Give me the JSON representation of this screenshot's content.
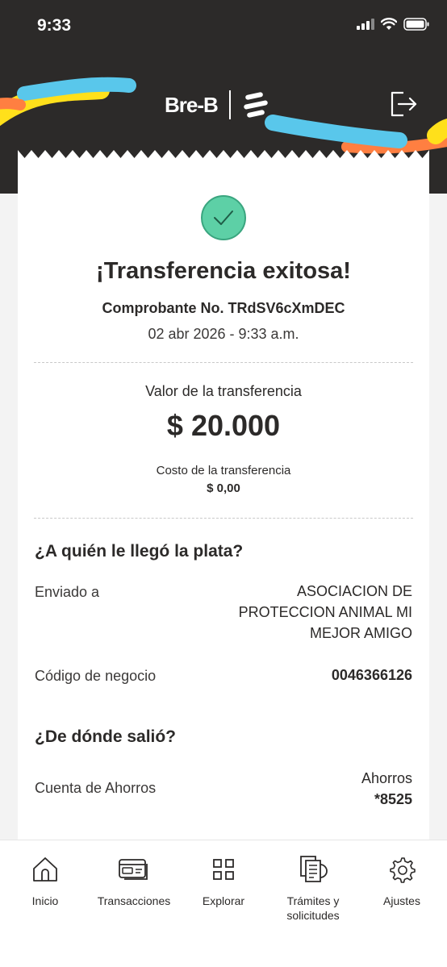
{
  "status_bar": {
    "time": "9:33"
  },
  "brand": {
    "name": "Bre-B"
  },
  "receipt": {
    "title": "¡Transferencia exitosa!",
    "voucher": "Comprobante No. TRdSV6cXmDEC",
    "datetime": "02 abr 2026 - 9:33 a.m.",
    "amount_label": "Valor de la transferencia",
    "amount": "$ 20.000",
    "cost_label": "Costo de la transferencia",
    "cost_value": "$ 0,00"
  },
  "recipient": {
    "title": "¿A quién le llegó la plata?",
    "sent_to_label": "Enviado a",
    "sent_to_lines": [
      "ASOCIACION DE",
      "PROTECCION ANIMAL MI",
      "MEJOR AMIGO"
    ],
    "business_code_label": "Código de negocio",
    "business_code": "0046366126"
  },
  "source": {
    "title": "¿De dónde salió?",
    "account_label": "Cuenta de Ahorros",
    "account_type": "Ahorros",
    "account_number": "*8525"
  },
  "tabs": [
    {
      "label": "Inicio",
      "icon": "home-icon"
    },
    {
      "label": "Transacciones",
      "icon": "card-icon"
    },
    {
      "label": "Explorar",
      "icon": "grid-icon"
    },
    {
      "label_line1": "Trámites y",
      "label_line2": "solicitudes",
      "icon": "documents-icon"
    },
    {
      "label": "Ajustes",
      "icon": "gear-icon"
    }
  ],
  "colors": {
    "header_bg": "#2c2a29",
    "success_green": "#5dd0a6",
    "stripe_blue": "#59c7eb",
    "stripe_yellow": "#ffe01b",
    "stripe_orange": "#ff7f41"
  }
}
